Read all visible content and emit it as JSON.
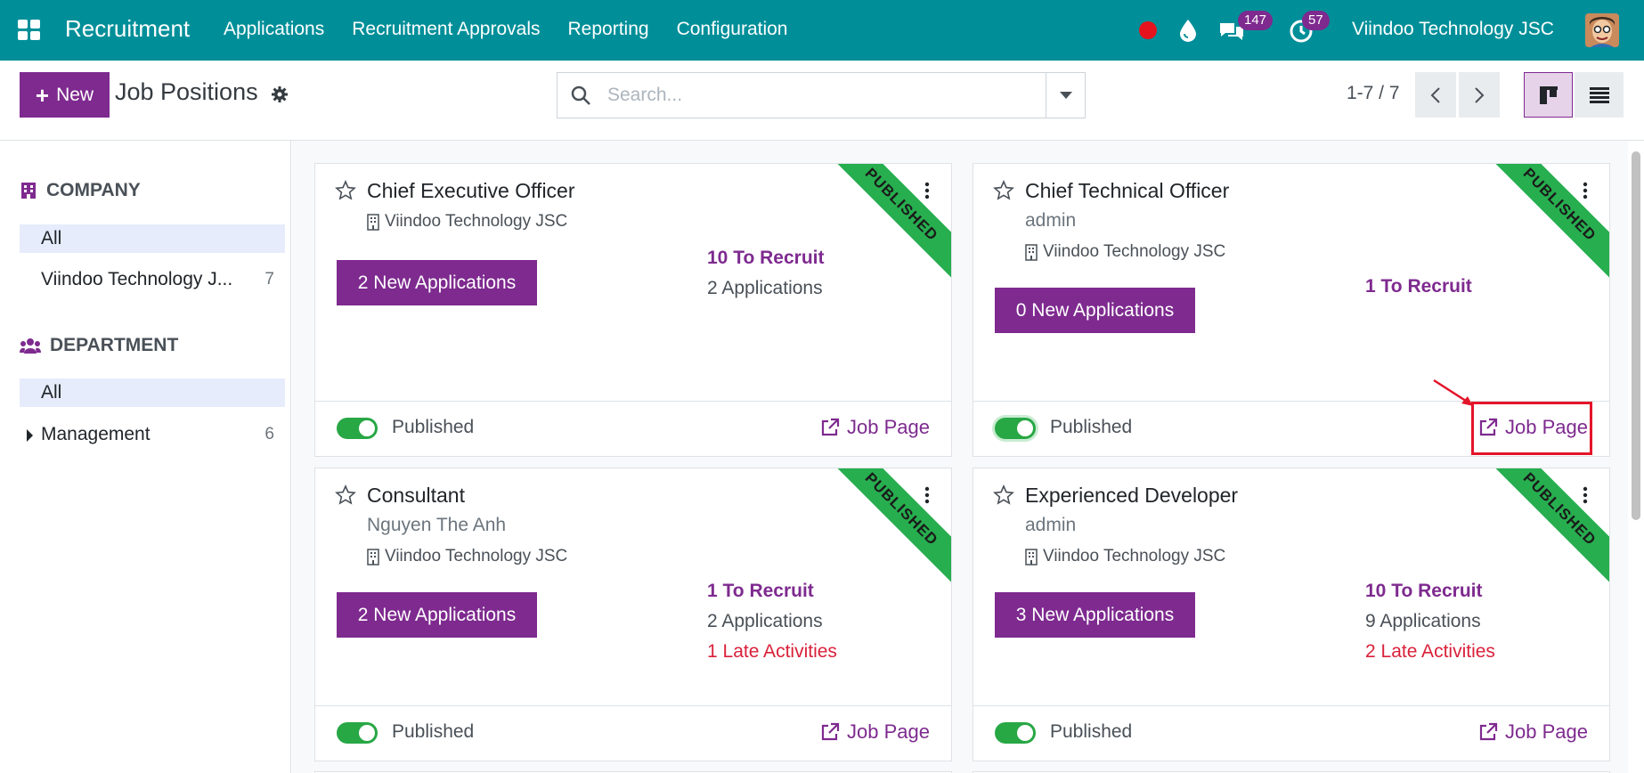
{
  "navbar": {
    "app_name": "Recruitment",
    "menu": [
      "Applications",
      "Recruitment Approvals",
      "Reporting",
      "Configuration"
    ],
    "messages_count": "147",
    "activities_count": "57",
    "company": "Viindoo Technology JSC",
    "colors": {
      "bar": "#008f99",
      "badge": "#7e2a8f",
      "record": "#e4131d"
    }
  },
  "control": {
    "new_label": "New",
    "title": "Job Positions",
    "search_placeholder": "Search...",
    "pager": "1-7 / 7"
  },
  "sidebar": {
    "company_heading": "COMPANY",
    "company_items": [
      {
        "label": "All",
        "count": ""
      },
      {
        "label": "Viindoo Technology J...",
        "count": "7"
      }
    ],
    "department_heading": "DEPARTMENT",
    "department_items": [
      {
        "label": "All",
        "count": ""
      },
      {
        "label": "Management",
        "count": "6"
      }
    ]
  },
  "cards": [
    {
      "title": "Chief Executive Officer",
      "manager": "",
      "company": "Viindoo Technology JSC",
      "new_applications": "2 New Applications",
      "to_recruit": "10 To Recruit",
      "applications": "2 Applications",
      "late_activities": "",
      "ribbon": "PUBLISHED",
      "published_label": "Published",
      "job_page": "Job Page"
    },
    {
      "title": "Chief Technical Officer",
      "manager": "admin",
      "company": "Viindoo Technology JSC",
      "new_applications": "0 New Applications",
      "to_recruit": "1 To Recruit",
      "applications": "",
      "late_activities": "",
      "ribbon": "PUBLISHED",
      "published_label": "Published",
      "job_page": "Job Page"
    },
    {
      "title": "Consultant",
      "manager": "Nguyen The Anh",
      "company": "Viindoo Technology JSC",
      "new_applications": "2 New Applications",
      "to_recruit": "1 To Recruit",
      "applications": "2 Applications",
      "late_activities": "1 Late Activities",
      "ribbon": "PUBLISHED",
      "published_label": "Published",
      "job_page": "Job Page"
    },
    {
      "title": "Experienced Developer",
      "manager": "admin",
      "company": "Viindoo Technology JSC",
      "new_applications": "3 New Applications",
      "to_recruit": "10 To Recruit",
      "applications": "9 Applications",
      "late_activities": "2 Late Activities",
      "ribbon": "PUBLISHED",
      "published_label": "Published",
      "job_page": "Job Page"
    }
  ],
  "accent_color": "#7e2a8f",
  "annotation_color": "#e3152a"
}
